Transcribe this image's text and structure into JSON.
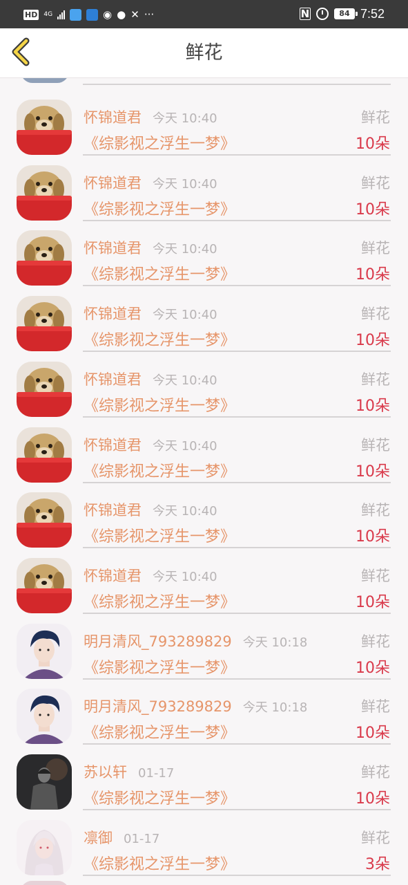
{
  "status_bar": {
    "hd": "HD",
    "network": "4G",
    "time": "7:52",
    "battery": "84",
    "icons": [
      "hd-icon",
      "signal-icon",
      "browser-app-icon",
      "wifi-hotspot-icon",
      "qq-icon",
      "wechat-icon",
      "translate-icon",
      "more-icon",
      "nfc-icon",
      "alarm-icon",
      "battery-icon"
    ]
  },
  "header": {
    "back_icon": "chevron-left-icon",
    "title": "鲜花"
  },
  "colors": {
    "name": "#e6956a",
    "count": "#d9394a",
    "muted": "#b8b4b5",
    "back_icon": "#f5d547"
  },
  "records": [
    {
      "user": "怀锦道君",
      "time": "今天 10:40",
      "gift": "鲜花",
      "book": "《综影视之浮生一梦》",
      "count": "10朵",
      "avatar": "dog"
    },
    {
      "user": "怀锦道君",
      "time": "今天 10:40",
      "gift": "鲜花",
      "book": "《综影视之浮生一梦》",
      "count": "10朵",
      "avatar": "dog"
    },
    {
      "user": "怀锦道君",
      "time": "今天 10:40",
      "gift": "鲜花",
      "book": "《综影视之浮生一梦》",
      "count": "10朵",
      "avatar": "dog"
    },
    {
      "user": "怀锦道君",
      "time": "今天 10:40",
      "gift": "鲜花",
      "book": "《综影视之浮生一梦》",
      "count": "10朵",
      "avatar": "dog"
    },
    {
      "user": "怀锦道君",
      "time": "今天 10:40",
      "gift": "鲜花",
      "book": "《综影视之浮生一梦》",
      "count": "10朵",
      "avatar": "dog"
    },
    {
      "user": "怀锦道君",
      "time": "今天 10:40",
      "gift": "鲜花",
      "book": "《综影视之浮生一梦》",
      "count": "10朵",
      "avatar": "dog"
    },
    {
      "user": "怀锦道君",
      "time": "今天 10:40",
      "gift": "鲜花",
      "book": "《综影视之浮生一梦》",
      "count": "10朵",
      "avatar": "dog"
    },
    {
      "user": "怀锦道君",
      "time": "今天 10:40",
      "gift": "鲜花",
      "book": "《综影视之浮生一梦》",
      "count": "10朵",
      "avatar": "dog"
    },
    {
      "user": "明月清风_793289829",
      "time": "今天 10:18",
      "gift": "鲜花",
      "book": "《综影视之浮生一梦》",
      "count": "10朵",
      "avatar": "boy"
    },
    {
      "user": "明月清风_793289829",
      "time": "今天 10:18",
      "gift": "鲜花",
      "book": "《综影视之浮生一梦》",
      "count": "10朵",
      "avatar": "boy"
    },
    {
      "user": "苏以轩",
      "time": "01-17",
      "gift": "鲜花",
      "book": "《综影视之浮生一梦》",
      "count": "10朵",
      "avatar": "dark"
    },
    {
      "user": "凛御",
      "time": "01-17",
      "gift": "鲜花",
      "book": "《综影视之浮生一梦》",
      "count": "3朵",
      "avatar": "girl"
    }
  ]
}
